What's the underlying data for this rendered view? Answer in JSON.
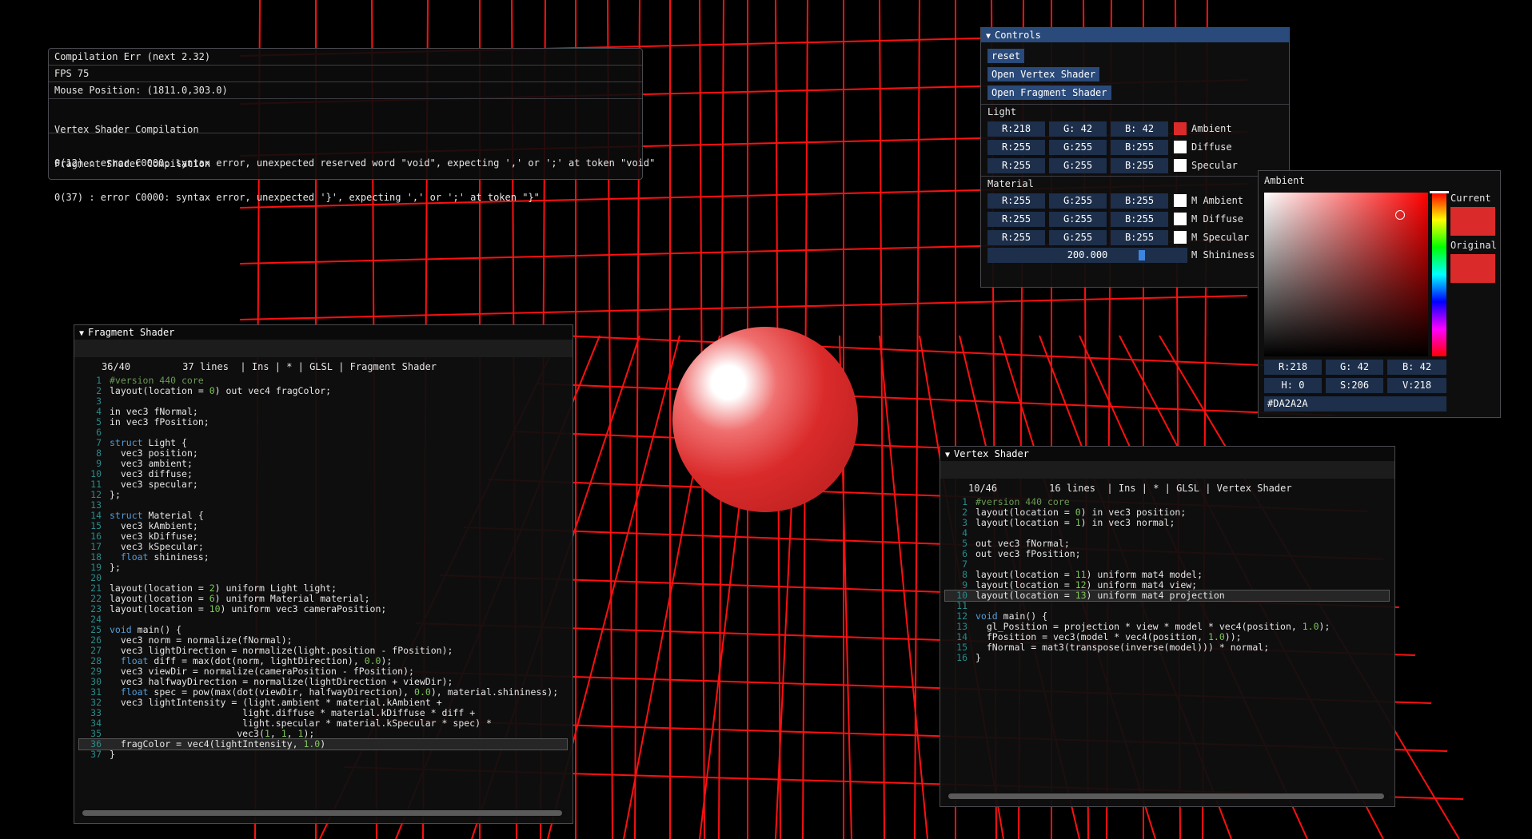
{
  "overlay": {
    "compile_status": "Compilation Err (next 2.32)",
    "fps": "FPS 75",
    "mouse_position": "Mouse Position: (1811.0,303.0)",
    "vertex_title": "Vertex Shader Compilation",
    "vertex_error": "0(12) : error C0000: syntax error, unexpected reserved word \"void\", expecting ',' or ';' at token \"void\"",
    "fragment_title": "Fragment Shader Compilation",
    "fragment_error": "0(37) : error C0000: syntax error, unexpected '}', expecting ',' or ';' at token \"}\""
  },
  "controls": {
    "title": "Controls",
    "reset_label": "reset",
    "open_vertex_label": "Open Vertex Shader",
    "open_fragment_label": "Open Fragment Shader",
    "light_label": "Light",
    "material_label": "Material",
    "light_rows": [
      {
        "r": "R:218",
        "g": "G: 42",
        "b": "B: 42",
        "color": "#DA2A2A",
        "label": "Ambient"
      },
      {
        "r": "R:255",
        "g": "G:255",
        "b": "B:255",
        "color": "#FFFFFF",
        "label": "Diffuse"
      },
      {
        "r": "R:255",
        "g": "G:255",
        "b": "B:255",
        "color": "#FFFFFF",
        "label": "Specular"
      }
    ],
    "material_rows": [
      {
        "r": "R:255",
        "g": "G:255",
        "b": "B:255",
        "color": "#FFFFFF",
        "label": "M Ambient"
      },
      {
        "r": "R:255",
        "g": "G:255",
        "b": "B:255",
        "color": "#FFFFFF",
        "label": "M Diffuse"
      },
      {
        "r": "R:255",
        "g": "G:255",
        "b": "B:255",
        "color": "#FFFFFF",
        "label": "M Specular"
      }
    ],
    "shininess_value": "200.000",
    "shininess_fraction": 0.78,
    "shininess_label": "M Shininess"
  },
  "picker": {
    "title": "Ambient",
    "current_label": "Current",
    "original_label": "Original",
    "current_color": "#DA2A2A",
    "original_color": "#DA2A2A",
    "r": "R:218",
    "g": "G: 42",
    "b": "B: 42",
    "h": "H:  0",
    "s": "S:206",
    "v": "V:218",
    "hex": "#DA2A2A"
  },
  "fragment_editor": {
    "title": "Fragment Shader",
    "status": "36/40         37 lines  | Ins | * | GLSL | Fragment Shader",
    "current_line": 36,
    "lines": [
      "#version 440 core",
      "layout(location = 0) out vec4 fragColor;",
      "",
      "in vec3 fNormal;",
      "in vec3 fPosition;",
      "",
      "struct Light {",
      "  vec3 position;",
      "  vec3 ambient;",
      "  vec3 diffuse;",
      "  vec3 specular;",
      "};",
      "",
      "struct Material {",
      "  vec3 kAmbient;",
      "  vec3 kDiffuse;",
      "  vec3 kSpecular;",
      "  float shininess;",
      "};",
      "",
      "layout(location = 2) uniform Light light;",
      "layout(location = 6) uniform Material material;",
      "layout(location = 10) uniform vec3 cameraPosition;",
      "",
      "void main() {",
      "  vec3 norm = normalize(fNormal);",
      "  vec3 lightDirection = normalize(light.position - fPosition);",
      "  float diff = max(dot(norm, lightDirection), 0.0);",
      "  vec3 viewDir = normalize(cameraPosition - fPosition);",
      "  vec3 halfwayDirection = normalize(lightDirection + viewDir);",
      "  float spec = pow(max(dot(viewDir, halfwayDirection), 0.0), material.shininess);",
      "  vec3 lightIntensity = (light.ambient * material.kAmbient +",
      "                        light.diffuse * material.kDiffuse * diff +",
      "                        light.specular * material.kSpecular * spec) *",
      "                       vec3(1, 1, 1);",
      "  fragColor = vec4(lightIntensity, 1.0)",
      "}"
    ]
  },
  "vertex_editor": {
    "title": "Vertex Shader",
    "status": "10/46         16 lines  | Ins | * | GLSL | Vertex Shader",
    "current_line": 10,
    "lines": [
      "#version 440 core",
      "layout(location = 0) in vec3 position;",
      "layout(location = 1) in vec3 normal;",
      "",
      "out vec3 fNormal;",
      "out vec3 fPosition;",
      "",
      "layout(location = 11) uniform mat4 model;",
      "layout(location = 12) uniform mat4 view;",
      "layout(location = 13) uniform mat4 projection",
      "",
      "void main() {",
      "  gl_Position = projection * view * model * vec4(position, 1.0);",
      "  fPosition = vec3(model * vec4(position, 1.0));",
      "  fNormal = mat3(transpose(inverse(model))) * normal;",
      "}"
    ]
  },
  "scene": {
    "grid_color": "#FF0000",
    "sphere_color": "#DA2A2A"
  }
}
